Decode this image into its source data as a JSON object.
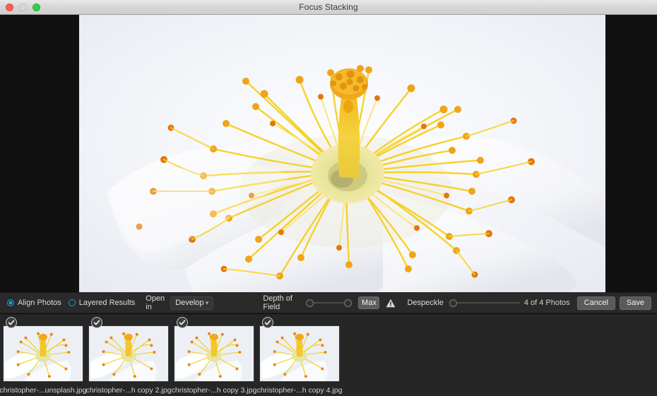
{
  "window": {
    "title": "Focus Stacking",
    "traffic_lights": [
      "close-button",
      "minimize-button",
      "zoom-button"
    ]
  },
  "canvas": {
    "preview_alt": "white-flower-macro-photo",
    "background_color": "#eef0f5"
  },
  "toolbar": {
    "align_photos_label": "Align Photos",
    "align_photos_selected": true,
    "layered_results_label": "Layered Results",
    "layered_results_selected": false,
    "open_in_label": "Open in",
    "open_in_value": "Develop",
    "open_in_options": [
      "Develop"
    ],
    "depth_of_field_label": "Depth of Field",
    "max_button_label": "Max",
    "warning_icon": "warning-triangle-icon",
    "despeckle_label": "Despeckle",
    "photo_count_text": "4 of 4 Photos",
    "cancel_label": "Cancel",
    "save_label": "Save",
    "accent_color": "#1a9fe0"
  },
  "filmstrip": {
    "thumbnails": [
      {
        "name": "christopher-...unsplash.jpg",
        "checked": true
      },
      {
        "name": "christopher-...h copy 2.jpg",
        "checked": true
      },
      {
        "name": "christopher-...h copy 3.jpg",
        "checked": true
      },
      {
        "name": "christopher-...h copy 4.jpg",
        "checked": true
      }
    ]
  }
}
